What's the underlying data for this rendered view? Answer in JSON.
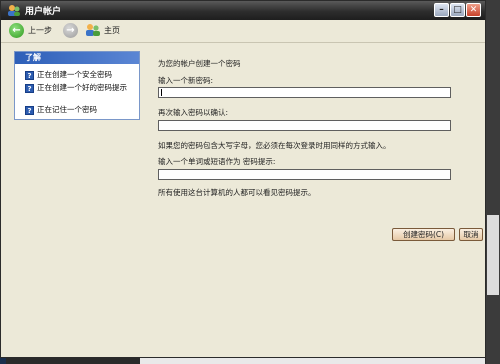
{
  "window": {
    "title": "用户帐户",
    "controls": {
      "minimize": "–",
      "maximize": "□",
      "close": "✕"
    }
  },
  "toolbar": {
    "back_label": "上一步",
    "home_label": "主页"
  },
  "sidebar": {
    "header": "了解",
    "items": [
      {
        "label": "正在创建一个安全密码"
      },
      {
        "label": "正在创建一个好的密码提示"
      },
      {
        "label": "正在记住一个密码"
      }
    ]
  },
  "form": {
    "heading": "为您的帐户创建一个密码",
    "new_password_label": "输入一个新密码:",
    "new_password_value": "",
    "confirm_label": "再次输入密码以确认:",
    "confirm_value": "",
    "case_note": "如果您的密码包含大写字母，您必须在每次登录时用同样的方式输入。",
    "hint_label": "输入一个单词或短语作为 密码提示:",
    "hint_value": "",
    "visibility_note": "所有使用这台计算机的人都可以看见密码提示。"
  },
  "actions": {
    "create_label": "创建密码(C)",
    "cancel_label": "取消"
  }
}
